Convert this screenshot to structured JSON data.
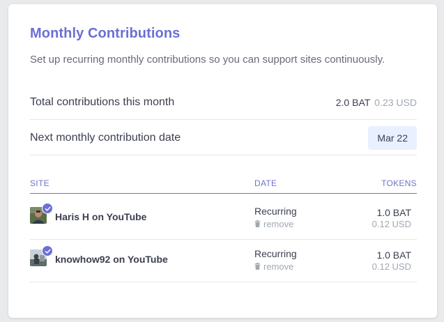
{
  "panel": {
    "title": "Monthly Contributions",
    "subtitle": "Set up recurring monthly contributions so you can support sites continuously."
  },
  "summary": {
    "total": {
      "label": "Total contributions this month",
      "bat": "2.0 BAT",
      "usd": "0.23 USD"
    },
    "next_date": {
      "label": "Next monthly contribution date",
      "value": "Mar 22"
    }
  },
  "table": {
    "headers": {
      "site": "SITE",
      "date": "DATE",
      "tokens": "TOKENS"
    },
    "rows": [
      {
        "site": "Haris H on YouTube",
        "date": "Recurring",
        "remove": "remove",
        "bat": "1.0 BAT",
        "usd": "0.12 USD"
      },
      {
        "site": "knowhow92 on YouTube",
        "date": "Recurring",
        "remove": "remove",
        "bat": "1.0 BAT",
        "usd": "0.12 USD"
      }
    ]
  },
  "colors": {
    "accent": "#6c6fd5",
    "text": "#3b3e4f",
    "muted": "#a1a8b2",
    "pill_bg": "#e9f0ff"
  },
  "icons": {
    "verified": "verified-check-icon",
    "trash": "trash-icon"
  }
}
